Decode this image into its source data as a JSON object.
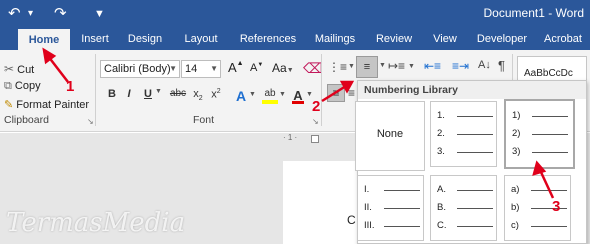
{
  "titlebar": {
    "document_title": "Document1 - Word",
    "undo_icon": "undo-icon",
    "redo_icon": "redo-icon",
    "customize_icon": "customize-quick-access-icon"
  },
  "tabs": [
    "Home",
    "Insert",
    "Design",
    "Layout",
    "References",
    "Mailings",
    "Review",
    "View",
    "Developer",
    "Acrobat"
  ],
  "active_tab": "Home",
  "clipboard": {
    "cut": "Cut",
    "copy": "Copy",
    "format_painter": "Format Painter",
    "label": "Clipboard"
  },
  "font": {
    "name": "Calibri (Body)",
    "size": "14",
    "grow": "A",
    "shrink": "A",
    "case": "Aa",
    "bold": "B",
    "italic": "I",
    "underline": "U",
    "strike": "abc",
    "subscript": "x",
    "subscript_sup": "2",
    "superscript": "x",
    "superscript_sup": "2",
    "effects": "A",
    "highlight": "ab",
    "color": "A",
    "label": "Font"
  },
  "styles": {
    "sample": "AaBbCcDc"
  },
  "numbering_library": {
    "header": "Numbering Library",
    "none": "None",
    "formats": [
      [
        "1.",
        "2.",
        "3."
      ],
      [
        "1)",
        "2)",
        "3)"
      ],
      [
        "I.",
        "II.",
        "III."
      ],
      [
        "A.",
        "B.",
        "C."
      ],
      [
        "a)",
        "b)",
        "c)"
      ]
    ]
  },
  "document": {
    "visible_text": "C"
  },
  "annotations": [
    "1",
    "2",
    "3"
  ],
  "watermark": "TermasMedia",
  "colors": {
    "title_bar": "#2b579a",
    "ribbon": "#f3f3f3",
    "annotation_red": "#e0001b",
    "font_color_underline": "#e00000",
    "highlight_underline": "#ffff00"
  }
}
